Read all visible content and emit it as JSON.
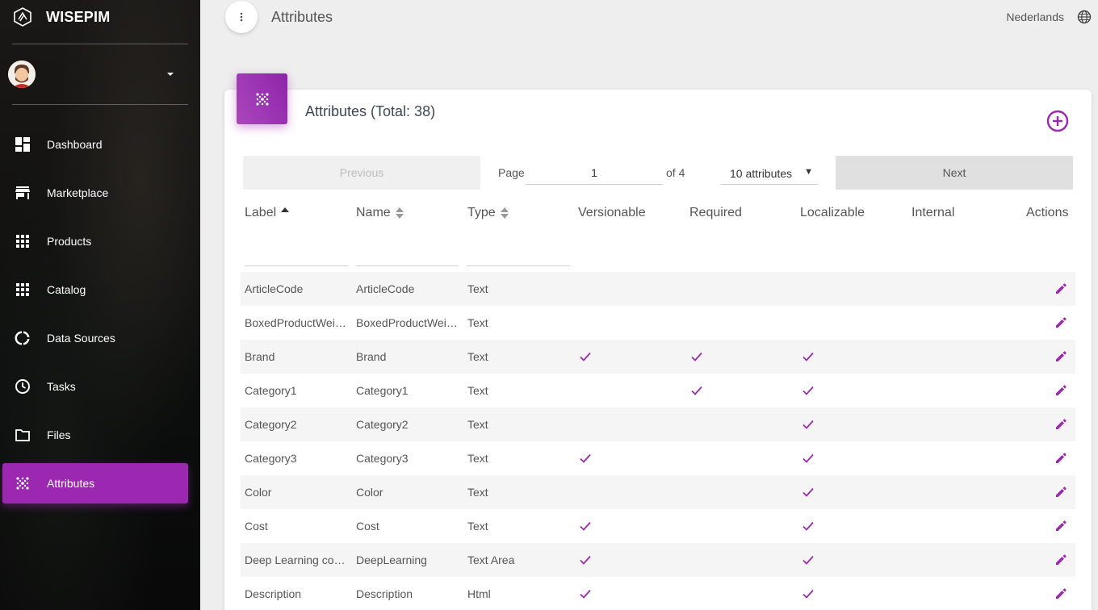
{
  "app": {
    "name": "WISEPIM"
  },
  "sidebar": {
    "items": [
      {
        "label": "Dashboard",
        "icon": "dashboard-icon"
      },
      {
        "label": "Marketplace",
        "icon": "store-icon"
      },
      {
        "label": "Products",
        "icon": "grid-icon"
      },
      {
        "label": "Catalog",
        "icon": "grid-icon"
      },
      {
        "label": "Data Sources",
        "icon": "donut-icon"
      },
      {
        "label": "Tasks",
        "icon": "clock-icon"
      },
      {
        "label": "Files",
        "icon": "folder-icon"
      },
      {
        "label": "Attributes",
        "icon": "dots-icon",
        "active": true
      }
    ]
  },
  "header": {
    "title": "Attributes",
    "language": "Nederlands"
  },
  "card": {
    "title": "Attributes (Total: 38)"
  },
  "pagination": {
    "previous": "Previous",
    "next": "Next",
    "page_label": "Page",
    "page_value": "1",
    "of_label": "of 4",
    "per_page": "10 attributes"
  },
  "table": {
    "columns": {
      "label": "Label",
      "name": "Name",
      "type": "Type",
      "versionable": "Versionable",
      "required": "Required",
      "localizable": "Localizable",
      "internal": "Internal",
      "actions": "Actions"
    },
    "rows": [
      {
        "label": "ArticleCode",
        "name": "ArticleCode",
        "type": "Text",
        "versionable": false,
        "required": false,
        "localizable": false,
        "internal": false
      },
      {
        "label": "BoxedProductWeig...",
        "name": "BoxedProductWeig...",
        "type": "Text",
        "versionable": false,
        "required": false,
        "localizable": false,
        "internal": false
      },
      {
        "label": "Brand",
        "name": "Brand",
        "type": "Text",
        "versionable": true,
        "required": true,
        "localizable": true,
        "internal": false
      },
      {
        "label": "Category1",
        "name": "Category1",
        "type": "Text",
        "versionable": false,
        "required": true,
        "localizable": true,
        "internal": false
      },
      {
        "label": "Category2",
        "name": "Category2",
        "type": "Text",
        "versionable": false,
        "required": false,
        "localizable": true,
        "internal": false
      },
      {
        "label": "Category3",
        "name": "Category3",
        "type": "Text",
        "versionable": true,
        "required": false,
        "localizable": true,
        "internal": false
      },
      {
        "label": "Color",
        "name": "Color",
        "type": "Text",
        "versionable": false,
        "required": false,
        "localizable": true,
        "internal": false
      },
      {
        "label": "Cost",
        "name": "Cost",
        "type": "Text",
        "versionable": true,
        "required": false,
        "localizable": true,
        "internal": false
      },
      {
        "label": "Deep Learning cont...",
        "name": "DeepLearning",
        "type": "Text Area",
        "versionable": true,
        "required": false,
        "localizable": true,
        "internal": false
      },
      {
        "label": "Description",
        "name": "Description",
        "type": "Html",
        "versionable": true,
        "required": false,
        "localizable": true,
        "internal": false
      }
    ]
  },
  "colors": {
    "accent": "#9c27b0"
  }
}
